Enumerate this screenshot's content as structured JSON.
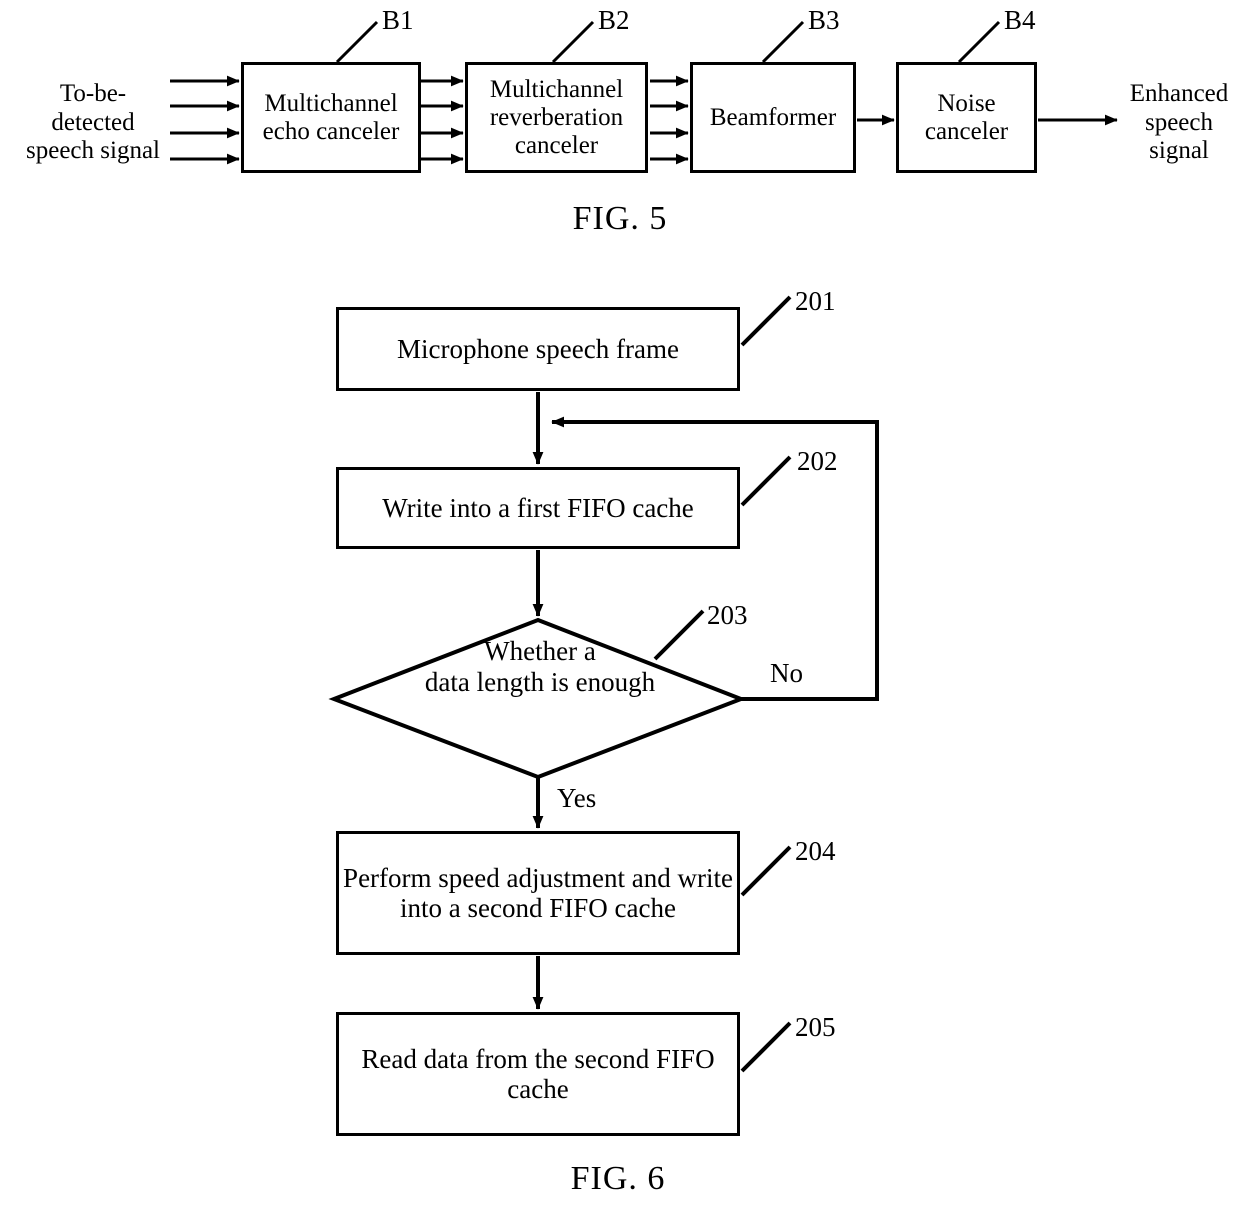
{
  "figures": [
    {
      "caption": "FIG. 5",
      "type": "block-diagram",
      "input_label": "To-be-\ndetected\nspeech signal",
      "output_label": "Enhanced\nspeech\nsignal",
      "blocks": [
        {
          "ref": "B1",
          "label": "Multichannel\necho canceler"
        },
        {
          "ref": "B2",
          "label": "Multichannel\nreverberation\ncanceler"
        },
        {
          "ref": "B3",
          "label": "Beamformer"
        },
        {
          "ref": "B4",
          "label": "Noise\ncanceler"
        }
      ],
      "channel_count": 4
    },
    {
      "caption": "FIG. 6",
      "type": "flowchart",
      "steps": [
        {
          "ref": "201",
          "label": "Microphone speech frame",
          "shape": "rect"
        },
        {
          "ref": "202",
          "label": "Write into a first FIFO cache",
          "shape": "rect"
        },
        {
          "ref": "203",
          "label": "Whether a\ndata length is enough",
          "shape": "diamond"
        },
        {
          "ref": "204",
          "label": "Perform speed adjustment and\nwrite into a second FIFO\ncache",
          "shape": "rect"
        },
        {
          "ref": "205",
          "label": "Read data from the second\nFIFO cache",
          "shape": "rect"
        }
      ],
      "branches": {
        "yes": "Yes",
        "no": "No"
      }
    }
  ],
  "colors": {
    "ink": "#000000",
    "paper": "#ffffff"
  }
}
